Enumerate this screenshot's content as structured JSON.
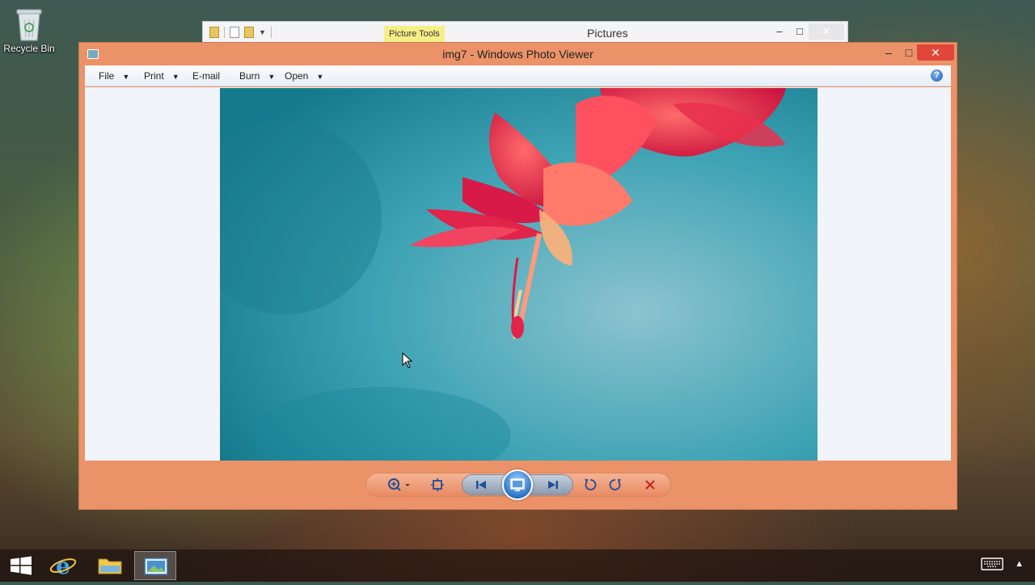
{
  "desktop": {
    "recycle_bin_label": "Recycle Bin"
  },
  "explorer": {
    "contextual_tab": "Picture Tools",
    "title": "Pictures",
    "minimize": "–",
    "maximize": "□",
    "close": "✕"
  },
  "viewer": {
    "title": "img7 - Windows Photo Viewer",
    "minimize": "–",
    "maximize": "□",
    "close": "✕",
    "menu": [
      {
        "label": "File",
        "has_dropdown": true
      },
      {
        "label": "Print",
        "has_dropdown": true
      },
      {
        "label": "E-mail",
        "has_dropdown": false
      },
      {
        "label": "Burn",
        "has_dropdown": true
      },
      {
        "label": "Open",
        "has_dropdown": true
      }
    ],
    "help": "?",
    "dropdown_arrow": "▼",
    "toolbar_icons": [
      "zoom-icon",
      "actual-size-icon",
      "previous-icon",
      "slideshow-icon",
      "next-icon",
      "rotate-counterclockwise-icon",
      "rotate-clockwise-icon",
      "delete-icon"
    ]
  },
  "taskbar": {
    "items": [
      "windows-start",
      "internet-explorer",
      "file-explorer",
      "photo-viewer"
    ],
    "active": "photo-viewer",
    "tray_caret": "▲"
  },
  "colors": {
    "window_accent": "#eb9268",
    "close_red": "#e0473a",
    "photo_background": "#3ea3b4",
    "flower": "#e0244a"
  }
}
